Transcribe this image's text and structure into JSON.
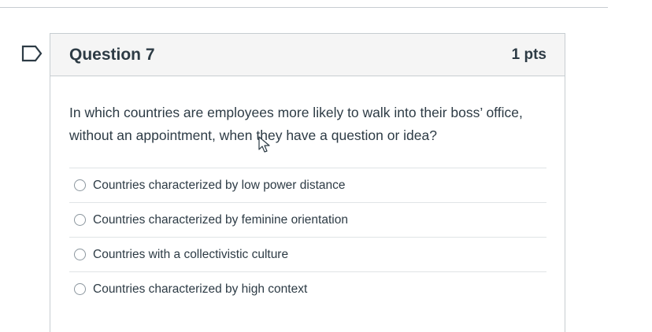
{
  "question": {
    "title": "Question 7",
    "points": "1 pts",
    "text": "In which countries are employees more likely to walk into their boss’ office, without an appointment, when they have a question or idea?",
    "answers": [
      {
        "label": "Countries characterized by low power distance"
      },
      {
        "label": "Countries characterized by feminine orientation"
      },
      {
        "label": "Countries with a collectivistic culture"
      },
      {
        "label": "Countries characterized by high context"
      }
    ]
  },
  "icons": {
    "flag": "flag-question-icon",
    "cursor": "mouse-pointer-icon"
  },
  "colors": {
    "text": "#2d3b45",
    "header_bg": "#f5f5f5",
    "border": "#c7cdd1"
  }
}
